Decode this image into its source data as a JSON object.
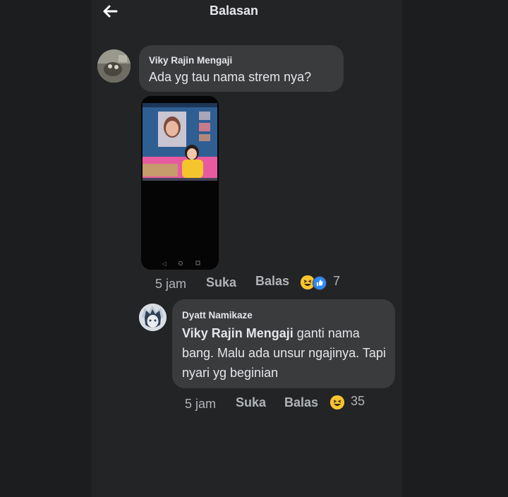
{
  "header": {
    "title": "Balasan",
    "back_icon": "arrow-left-icon"
  },
  "comments": [
    {
      "author": "Viky Rajin Mengaji",
      "text": "Ada yg tau nama strem nya?",
      "time": "5 jam",
      "like_label": "Suka",
      "reply_label": "Balas",
      "reactions": [
        "haha-icon",
        "like-icon"
      ],
      "reaction_count": "7"
    },
    {
      "author": "Dyatt Namikaze",
      "mention": "Viky Rajin Mengaji",
      "text": " ganti nama bang. Malu ada unsur ngajinya. Tapi nyari yg beginian",
      "time": "5 jam",
      "like_label": "Suka",
      "reply_label": "Balas",
      "reactions": [
        "haha-icon"
      ],
      "reaction_count": "35"
    }
  ],
  "colors": {
    "background": "#232425",
    "bubble": "#3a3b3c",
    "text": "#e4e6eb",
    "meta": "#b0b3b8",
    "haha": "#f7c531",
    "like": "#2d88ff"
  }
}
